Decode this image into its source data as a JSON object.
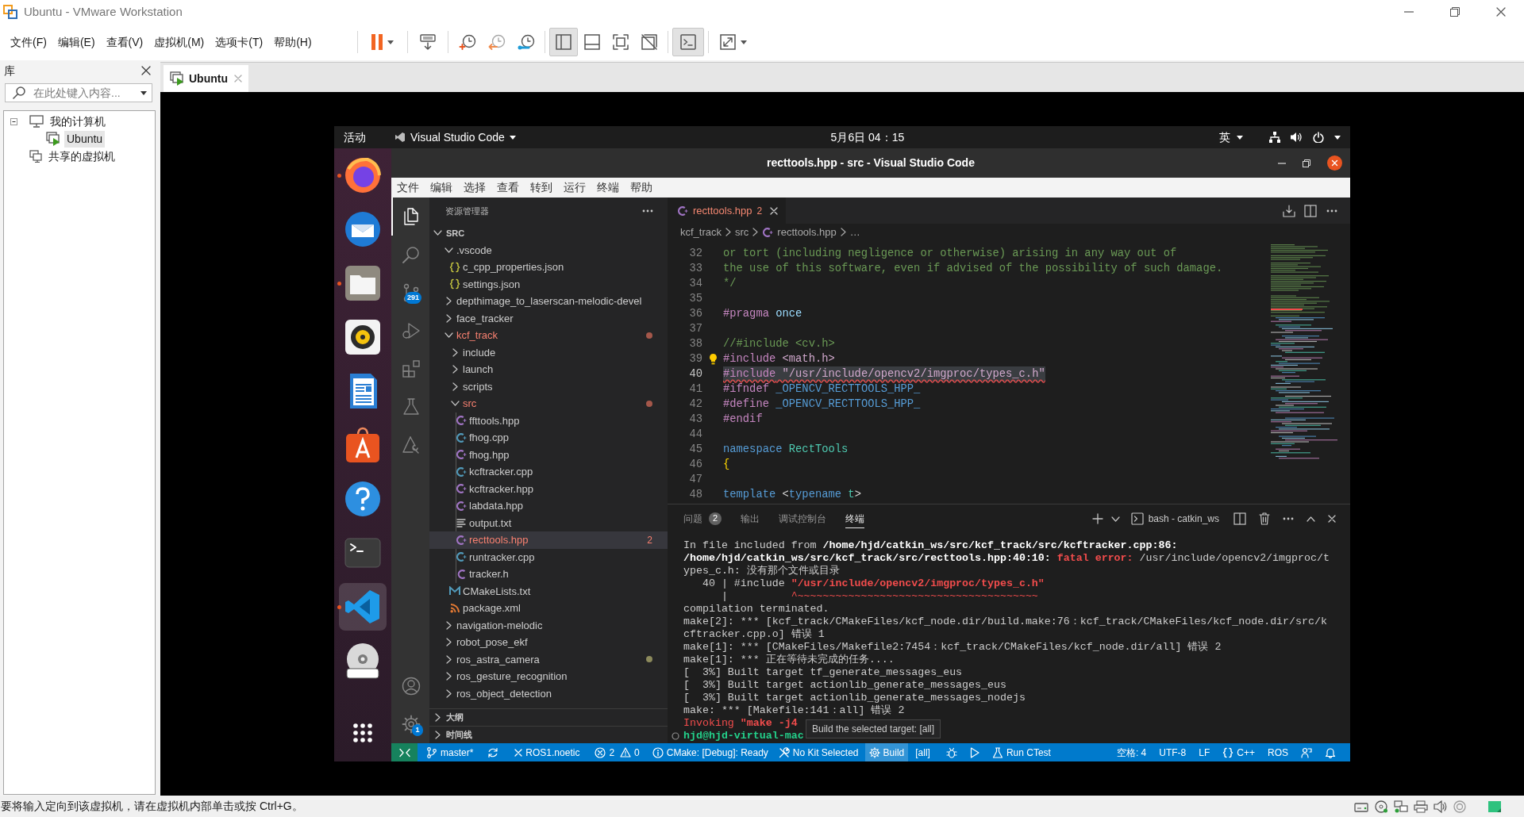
{
  "vmware": {
    "title": "Ubuntu - VMware Workstation",
    "menu": [
      "文件(F)",
      "编辑(E)",
      "查看(V)",
      "虚拟机(M)",
      "选项卡(T)",
      "帮助(H)"
    ],
    "toolbar": [
      {
        "kind": "separator"
      },
      {
        "kind": "pause",
        "on": false
      },
      {
        "kind": "separator"
      },
      {
        "kind": "send-keys",
        "on": false
      },
      {
        "kind": "separator"
      },
      {
        "kind": "snapshot",
        "on": false
      },
      {
        "kind": "revert",
        "on": false
      },
      {
        "kind": "snapshot-manager",
        "on": false
      },
      {
        "kind": "separator"
      },
      {
        "kind": "library-view",
        "on": true
      },
      {
        "kind": "thumbnail-view",
        "on": false
      },
      {
        "kind": "full-screen",
        "on": false
      },
      {
        "kind": "unity",
        "on": false
      },
      {
        "kind": "separator"
      },
      {
        "kind": "console-view",
        "on": true
      },
      {
        "kind": "separator"
      },
      {
        "kind": "stretch",
        "on": false
      }
    ],
    "library": {
      "title": "库",
      "search": {
        "placeholder": "在此处键入内容..."
      },
      "tree": [
        {
          "label": "我的计算机",
          "kind": "computer",
          "expanded": true,
          "selected": false,
          "children": [
            {
              "label": "Ubuntu",
              "kind": "vm",
              "selected": true
            }
          ]
        },
        {
          "label": "共享的虚拟机",
          "kind": "shared",
          "selected": false
        }
      ]
    },
    "tabs": [
      {
        "label": "Ubuntu",
        "selected": true
      }
    ],
    "status": "要将输入定向到该虚拟机，请在虚拟机内部单击或按 Ctrl+G。"
  },
  "ubuntu": {
    "activities": "活动",
    "app_menu": "Visual Studio Code",
    "clock": "5月6日 04：15",
    "input_method": "英",
    "dock": [
      {
        "kind": "firefox",
        "running": true,
        "selected": false
      },
      {
        "kind": "thunderbird",
        "running": false,
        "selected": false
      },
      {
        "kind": "files",
        "running": true,
        "selected": false
      },
      {
        "kind": "rhythmbox",
        "running": false,
        "selected": false
      },
      {
        "kind": "writer",
        "running": false,
        "selected": false
      },
      {
        "kind": "software",
        "running": false,
        "selected": false
      },
      {
        "kind": "help",
        "running": false,
        "selected": false
      },
      {
        "kind": "terminal",
        "running": false,
        "selected": false
      },
      {
        "kind": "vscode",
        "running": true,
        "selected": true
      },
      {
        "kind": "dvd",
        "running": false,
        "selected": false
      }
    ]
  },
  "vscode": {
    "title": "recttools.hpp - src - Visual Studio Code",
    "menu": [
      "文件",
      "编辑",
      "选择",
      "查看",
      "转到",
      "运行",
      "终端",
      "帮助"
    ],
    "activity": [
      {
        "kind": "explorer",
        "selected": true
      },
      {
        "kind": "search",
        "selected": false
      },
      {
        "kind": "source-control",
        "selected": false,
        "badge": "291"
      },
      {
        "kind": "run-debug",
        "selected": false
      },
      {
        "kind": "extensions",
        "selected": false
      },
      {
        "kind": "testing",
        "selected": false
      },
      {
        "kind": "cmake",
        "selected": false
      }
    ],
    "activity_bottom": [
      {
        "kind": "account",
        "selected": false
      },
      {
        "kind": "manage",
        "selected": false,
        "badge": "1"
      }
    ],
    "explorer": {
      "title": "资源管理器",
      "root": "SRC",
      "root_expanded": true,
      "tree": [
        {
          "label": ".vscode",
          "kind": "folder",
          "expanded": true,
          "error": false,
          "selected": false,
          "children": [
            {
              "label": "c_cpp_properties.json",
              "kind": "json",
              "error": false,
              "selected": false
            },
            {
              "label": "settings.json",
              "kind": "json",
              "error": false,
              "selected": false
            }
          ]
        },
        {
          "label": "depthimage_to_laserscan-melodic-devel",
          "kind": "folder",
          "expanded": false,
          "error": false,
          "selected": false
        },
        {
          "label": "face_tracker",
          "kind": "folder",
          "expanded": false,
          "error": false,
          "selected": false
        },
        {
          "label": "kcf_track",
          "kind": "folder",
          "expanded": true,
          "error": true,
          "selected": false,
          "color": "#a4574a",
          "children": [
            {
              "label": "include",
              "kind": "folder",
              "expanded": false,
              "error": false,
              "selected": false
            },
            {
              "label": "launch",
              "kind": "folder",
              "expanded": false,
              "error": false,
              "selected": false
            },
            {
              "label": "scripts",
              "kind": "folder",
              "expanded": false,
              "error": false,
              "selected": false
            },
            {
              "label": "src",
              "kind": "folder",
              "expanded": true,
              "error": true,
              "selected": false,
              "color": "#a4574a",
              "children": [
                {
                  "label": "ffttools.hpp",
                  "kind": "hpp",
                  "error": false,
                  "selected": false
                },
                {
                  "label": "fhog.cpp",
                  "kind": "cpp",
                  "error": false,
                  "selected": false
                },
                {
                  "label": "fhog.hpp",
                  "kind": "hpp",
                  "error": false,
                  "selected": false
                },
                {
                  "label": "kcftracker.cpp",
                  "kind": "cpp",
                  "error": false,
                  "selected": false
                },
                {
                  "label": "kcftracker.hpp",
                  "kind": "hpp",
                  "error": false,
                  "selected": false
                },
                {
                  "label": "labdata.hpp",
                  "kind": "hpp",
                  "error": false,
                  "selected": false
                },
                {
                  "label": "output.txt",
                  "kind": "text",
                  "error": false,
                  "selected": false
                },
                {
                  "label": "recttools.hpp",
                  "kind": "hpp",
                  "error": true,
                  "selected": true,
                  "problems": "2"
                },
                {
                  "label": "runtracker.cpp",
                  "kind": "cpp",
                  "error": false,
                  "selected": false
                },
                {
                  "label": "tracker.h",
                  "kind": "h",
                  "error": false,
                  "selected": false
                }
              ]
            },
            {
              "label": "CMakeLists.txt",
              "kind": "cmake",
              "error": false,
              "selected": false
            },
            {
              "label": "package.xml",
              "kind": "xml",
              "error": false,
              "selected": false
            }
          ]
        },
        {
          "label": "navigation-melodic",
          "kind": "folder",
          "expanded": false,
          "error": false,
          "selected": false
        },
        {
          "label": "robot_pose_ekf",
          "kind": "folder",
          "expanded": false,
          "error": false,
          "selected": false
        },
        {
          "label": "ros_astra_camera",
          "kind": "folder",
          "expanded": false,
          "error": false,
          "selected": false,
          "color": "#8c8a5c"
        },
        {
          "label": "ros_gesture_recognition",
          "kind": "folder",
          "expanded": false,
          "error": false,
          "selected": false
        },
        {
          "label": "ros_object_detection",
          "kind": "folder",
          "expanded": false,
          "error": false,
          "selected": false
        }
      ]
    },
    "sections": [
      {
        "label": "大纲",
        "expanded": false
      },
      {
        "label": "时间线",
        "expanded": false
      }
    ],
    "editor": {
      "tabs": [
        {
          "label": "recttools.hpp",
          "kind": "hpp",
          "problems": "2",
          "error": true,
          "selected": true
        }
      ],
      "breadcrumbs": [
        {
          "label": "kcf_track",
          "kind": "folder"
        },
        {
          "label": "src",
          "kind": "folder"
        },
        {
          "label": "recttools.hpp",
          "kind": "hpp"
        },
        {
          "label": "…",
          "kind": "symbols"
        }
      ],
      "lines": [
        {
          "number": "32",
          "current": false,
          "error": false,
          "lightbulb": false,
          "tokens": [
            {
              "kind": "comment",
              "text": "or tort (including negligence or otherwise) arising in any way out of"
            }
          ]
        },
        {
          "number": "33",
          "current": false,
          "error": false,
          "lightbulb": false,
          "tokens": [
            {
              "kind": "comment",
              "text": "the use of this software, even if advised of the possibility of such damage."
            }
          ]
        },
        {
          "number": "34",
          "current": false,
          "error": false,
          "lightbulb": false,
          "tokens": [
            {
              "kind": "comment",
              "text": "*/"
            }
          ]
        },
        {
          "number": "35",
          "current": false,
          "error": false,
          "lightbulb": false
        },
        {
          "number": "36",
          "current": false,
          "error": false,
          "lightbulb": false,
          "tokens": [
            {
              "kind": "directive",
              "text": "#pragma"
            },
            {
              "kind": "variable",
              "text": " once"
            }
          ]
        },
        {
          "number": "37",
          "current": false,
          "error": false,
          "lightbulb": false
        },
        {
          "number": "38",
          "current": false,
          "error": false,
          "lightbulb": false,
          "tokens": [
            {
              "kind": "comment",
              "text": "//#include <cv.h>"
            }
          ]
        },
        {
          "number": "39",
          "current": false,
          "error": false,
          "lightbulb": true,
          "tokens": [
            {
              "kind": "directive",
              "text": "#include"
            },
            {
              "kind": "header",
              "text": " <math.h>"
            }
          ]
        },
        {
          "number": "40",
          "current": true,
          "error": true,
          "lightbulb": false,
          "tokens": [
            {
              "kind": "directive",
              "text": "#include"
            },
            {
              "kind": "header",
              "text": " \"/usr/include/opencv2/imgproc/types_c.h\""
            }
          ]
        },
        {
          "number": "41",
          "current": false,
          "error": false,
          "lightbulb": false,
          "tokens": [
            {
              "kind": "directive",
              "text": "#ifndef"
            },
            {
              "kind": "macro",
              "text": " _OPENCV_RECTTOOLS_HPP_"
            }
          ]
        },
        {
          "number": "42",
          "current": false,
          "error": false,
          "lightbulb": false,
          "tokens": [
            {
              "kind": "directive",
              "text": "#define"
            },
            {
              "kind": "macro",
              "text": " _OPENCV_RECTTOOLS_HPP_"
            }
          ]
        },
        {
          "number": "43",
          "current": false,
          "error": false,
          "lightbulb": false,
          "tokens": [
            {
              "kind": "directive",
              "text": "#endif"
            }
          ]
        },
        {
          "number": "44",
          "current": false,
          "error": false,
          "lightbulb": false
        },
        {
          "number": "45",
          "current": false,
          "error": false,
          "lightbulb": false,
          "tokens": [
            {
              "kind": "keyword",
              "text": "namespace"
            },
            {
              "kind": "type",
              "text": " RectTools"
            }
          ]
        },
        {
          "number": "46",
          "current": false,
          "error": false,
          "lightbulb": false,
          "tokens": [
            {
              "kind": "brace",
              "text": "{"
            }
          ]
        },
        {
          "number": "47",
          "current": false,
          "error": false,
          "lightbulb": false
        },
        {
          "number": "48",
          "current": false,
          "error": false,
          "lightbulb": false,
          "tokens": [
            {
              "kind": "keyword",
              "text": "template"
            },
            {
              "kind": "plain",
              "text": " <"
            },
            {
              "kind": "keyword",
              "text": "typename"
            },
            {
              "kind": "type",
              "text": " t"
            },
            {
              "kind": "plain",
              "text": ">"
            }
          ]
        }
      ]
    },
    "panel": {
      "tabs": [
        {
          "label": "问题",
          "badge": "2",
          "selected": false
        },
        {
          "label": "输出",
          "selected": false
        },
        {
          "label": "调试控制台",
          "selected": false
        },
        {
          "label": "终端",
          "selected": true
        }
      ],
      "terminal_name": "bash - catkin_ws",
      "lines": [
        {
          "kind": "output",
          "parts": [
            {
              "kind": "text",
              "text": "In file included from "
            },
            {
              "kind": "path",
              "text": "/home/hjd/catkin_ws/src/kcf_track/src/kcftracker.cpp:86:"
            }
          ]
        },
        {
          "kind": "output",
          "parts": [
            {
              "kind": "path",
              "text": "/home/hjd/catkin_ws/src/kcf_track/src/recttools.hpp:40:10:"
            },
            {
              "kind": "error",
              "text": " fatal error:"
            },
            {
              "kind": "text",
              "text": " /usr/include/opencv2/imgproc/t"
            }
          ]
        },
        {
          "kind": "output",
          "parts": [
            {
              "kind": "text",
              "text": "ypes_c.h: 没有那个文件或目录"
            }
          ]
        },
        {
          "kind": "output",
          "parts": [
            {
              "kind": "text",
              "text": "   40 | #include "
            },
            {
              "kind": "error",
              "text": "\"/usr/include/opencv2/imgproc/types_c.h\""
            }
          ]
        },
        {
          "kind": "output",
          "parts": [
            {
              "kind": "text",
              "text": "      |          "
            },
            {
              "kind": "caret",
              "text": "^~~~~~~~~~~~~~~~~~~~~~~~~~~~~~~~~~~~~~~"
            }
          ]
        },
        {
          "kind": "output",
          "parts": [
            {
              "kind": "text",
              "text": "compilation terminated."
            }
          ]
        },
        {
          "kind": "output",
          "parts": [
            {
              "kind": "text",
              "text": "make[2]: *** [kcf_track/CMakeFiles/kcf_node.dir/build.make:76：kcf_track/CMakeFiles/kcf_node.dir/src/k"
            }
          ]
        },
        {
          "kind": "output",
          "parts": [
            {
              "kind": "text",
              "text": "cftracker.cpp.o] 错误 1"
            }
          ]
        },
        {
          "kind": "output",
          "parts": [
            {
              "kind": "text",
              "text": "make[1]: *** [CMakeFiles/Makefile2:7454：kcf_track/CMakeFiles/kcf_node.dir/all] 错误 2"
            }
          ]
        },
        {
          "kind": "output",
          "parts": [
            {
              "kind": "text",
              "text": "make[1]: *** 正在等待未完成的任务...."
            }
          ]
        },
        {
          "kind": "output",
          "parts": [
            {
              "kind": "text",
              "text": "[  3%] Built target tf_generate_messages_eus"
            }
          ]
        },
        {
          "kind": "output",
          "parts": [
            {
              "kind": "text",
              "text": "[  3%] Built target actionlib_generate_messages_eus"
            }
          ]
        },
        {
          "kind": "output",
          "parts": [
            {
              "kind": "text",
              "text": "[  3%] Built target actionlib_generate_messages_nodejs"
            }
          ]
        },
        {
          "kind": "output",
          "parts": [
            {
              "kind": "text",
              "text": "make: *** [Makefile:141：all] 错误 2"
            }
          ]
        },
        {
          "kind": "output",
          "parts": [
            {
              "kind": "notice",
              "text": "Invoking "
            },
            {
              "kind": "error",
              "text": "\"make -j4"
            }
          ]
        },
        {
          "kind": "command",
          "parts": [
            {
              "kind": "prompt",
              "text": "hjd@hjd-virtual-mac"
            }
          ]
        }
      ]
    },
    "tooltip": "Build the selected target: [all]",
    "status_left": [
      {
        "kind": "remote",
        "highlighted": false
      },
      {
        "kind": "branch",
        "text": "master*",
        "highlighted": false
      },
      {
        "kind": "sync",
        "highlighted": false
      },
      {
        "kind": "ros",
        "text": "ROS1.noetic",
        "highlighted": false
      },
      {
        "kind": "problems",
        "errors": "2",
        "warnings": "0",
        "highlighted": false
      },
      {
        "kind": "cmake",
        "text": "CMake: [Debug]: Ready",
        "highlighted": false
      },
      {
        "kind": "kit",
        "text": "No Kit Selected",
        "highlighted": false
      },
      {
        "kind": "build",
        "text": "Build",
        "highlighted": true
      },
      {
        "kind": "target",
        "text": "[all]",
        "highlighted": false
      },
      {
        "kind": "debug",
        "highlighted": false
      },
      {
        "kind": "launch",
        "highlighted": false
      },
      {
        "kind": "ctest",
        "text": "Run CTest",
        "highlighted": false
      }
    ],
    "status_right": [
      {
        "kind": "indent",
        "text": "空格: 4"
      },
      {
        "kind": "encoding",
        "text": "UTF-8"
      },
      {
        "kind": "eol",
        "text": "LF"
      },
      {
        "kind": "language",
        "text": "C++"
      },
      {
        "kind": "ros-status",
        "text": "ROS"
      },
      {
        "kind": "feedback"
      },
      {
        "kind": "notifications"
      }
    ]
  }
}
